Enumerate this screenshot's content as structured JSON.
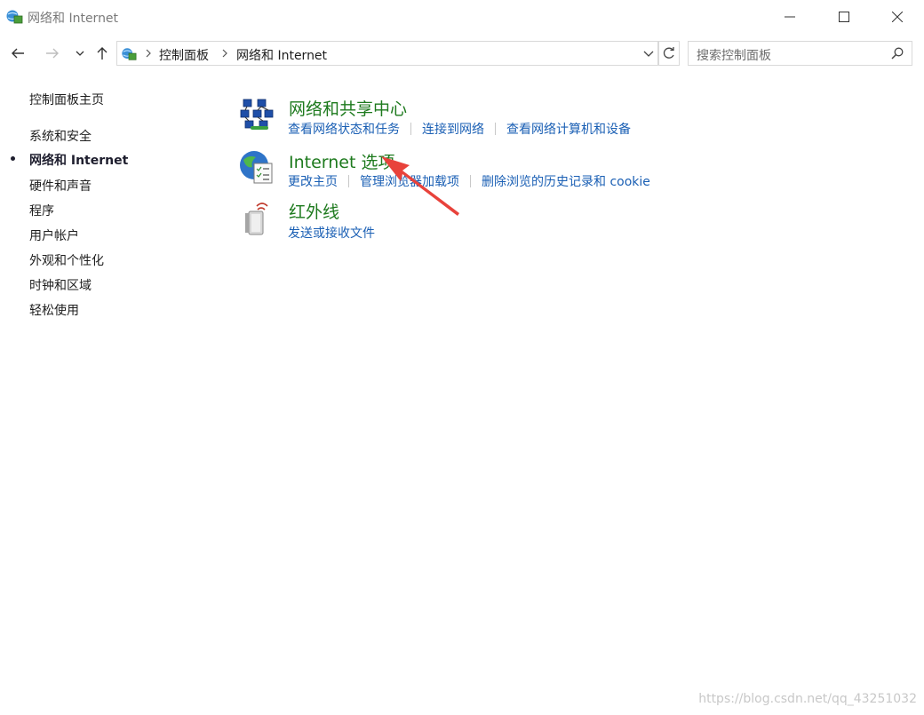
{
  "window": {
    "title": "网络和 Internet"
  },
  "address": {
    "crumbs": [
      "控制面板",
      "网络和 Internet"
    ]
  },
  "search": {
    "placeholder": "搜索控制面板"
  },
  "sidebar": {
    "items": [
      {
        "label": "控制面板主页",
        "active": false
      },
      {
        "label": "系统和安全",
        "active": false
      },
      {
        "label": "网络和 Internet",
        "active": true
      },
      {
        "label": "硬件和声音",
        "active": false
      },
      {
        "label": "程序",
        "active": false
      },
      {
        "label": "用户帐户",
        "active": false
      },
      {
        "label": "外观和个性化",
        "active": false
      },
      {
        "label": "时钟和区域",
        "active": false
      },
      {
        "label": "轻松使用",
        "active": false
      }
    ]
  },
  "categories": [
    {
      "title": "网络和共享中心",
      "icon": "network-sharing-icon",
      "links": [
        "查看网络状态和任务",
        "连接到网络",
        "查看网络计算机和设备"
      ]
    },
    {
      "title": "Internet 选项",
      "icon": "internet-options-icon",
      "links": [
        "更改主页",
        "管理浏览器加载项",
        "删除浏览的历史记录和 cookie"
      ]
    },
    {
      "title": "红外线",
      "icon": "infrared-icon",
      "links": [
        "发送或接收文件"
      ]
    }
  ],
  "colors": {
    "category_title": "#1e7a1e",
    "link": "#1a5fb4",
    "annotation_arrow": "#e8423b"
  },
  "watermark": "https://blog.csdn.net/qq_43251032"
}
